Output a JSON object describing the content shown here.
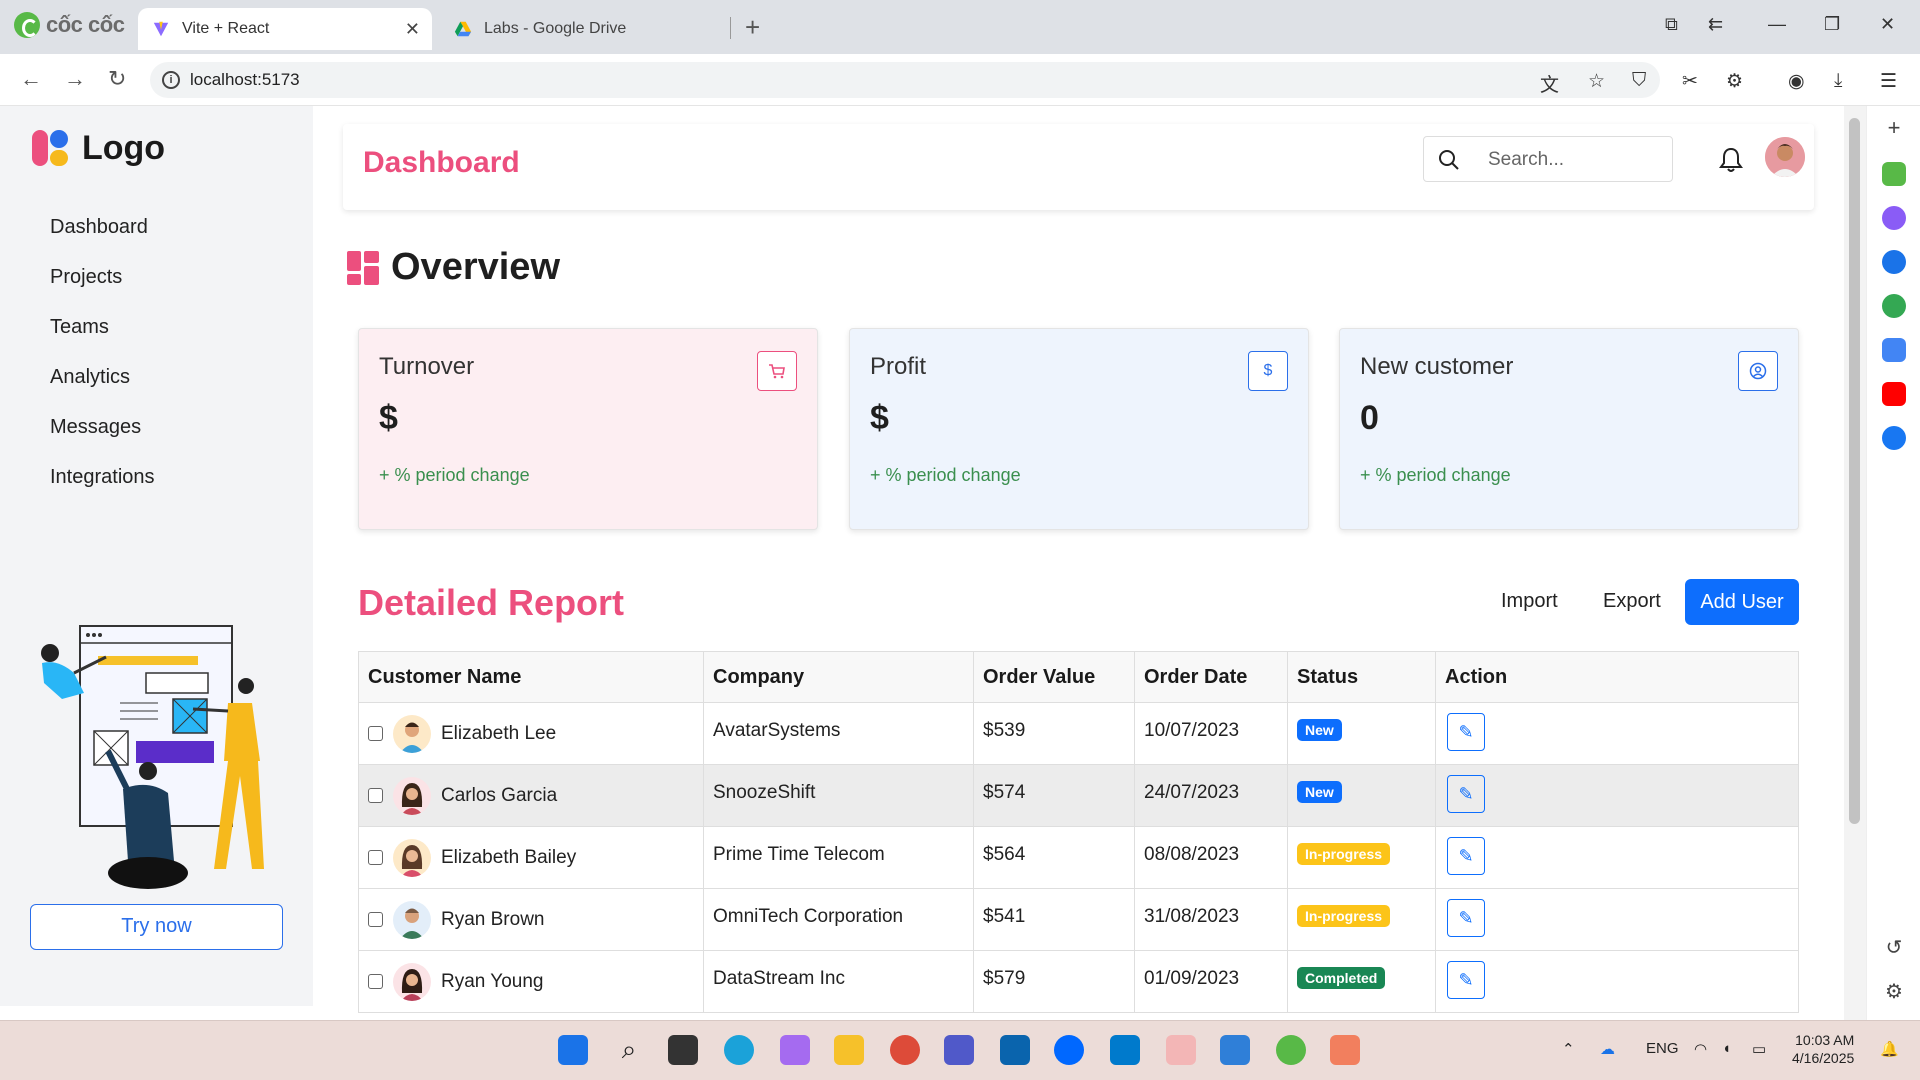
{
  "browser": {
    "brand": "cốc cốc",
    "tabs": [
      {
        "title": "Vite + React",
        "active": true
      },
      {
        "title": "Labs - Google Drive",
        "active": false
      }
    ],
    "url": "localhost:5173"
  },
  "sidebar": {
    "logo_text": "Logo",
    "items": [
      {
        "label": "Dashboard"
      },
      {
        "label": "Projects"
      },
      {
        "label": "Teams"
      },
      {
        "label": "Analytics"
      },
      {
        "label": "Messages"
      },
      {
        "label": "Integrations"
      }
    ],
    "cta_label": "Try now"
  },
  "header": {
    "title": "Dashboard",
    "search_placeholder": "Search..."
  },
  "overview": {
    "title": "Overview",
    "cards": [
      {
        "label": "Turnover",
        "value": "$",
        "change": "+ % period change",
        "icon": "cart-icon",
        "color": "#ec4f7e",
        "bg": "#fdeef2"
      },
      {
        "label": "Profit",
        "value": "$",
        "change": "+ % period change",
        "icon": "dollar-icon",
        "color": "#2b6fea",
        "bg": "#eef4fd"
      },
      {
        "label": "New customer",
        "value": "0",
        "change": "+ % period change",
        "icon": "user-circle-icon",
        "color": "#2b6fea",
        "bg": "#eef4fd"
      }
    ]
  },
  "report": {
    "title": "Detailed Report",
    "import_label": "Import",
    "export_label": "Export",
    "add_label": "Add User",
    "columns": [
      "Customer Name",
      "Company",
      "Order Value",
      "Order Date",
      "Status",
      "Action"
    ],
    "rows": [
      {
        "name": "Elizabeth Lee",
        "company": "AvatarSystems",
        "value": "$539",
        "date": "10/07/2023",
        "status": "New"
      },
      {
        "name": "Carlos Garcia",
        "company": "SnoozeShift",
        "value": "$574",
        "date": "24/07/2023",
        "status": "New"
      },
      {
        "name": "Elizabeth Bailey",
        "company": "Prime Time Telecom",
        "value": "$564",
        "date": "08/08/2023",
        "status": "In-progress"
      },
      {
        "name": "Ryan Brown",
        "company": "OmniTech Corporation",
        "value": "$541",
        "date": "31/08/2023",
        "status": "In-progress"
      },
      {
        "name": "Ryan Young",
        "company": "DataStream Inc",
        "value": "$579",
        "date": "01/09/2023",
        "status": "Completed"
      }
    ]
  },
  "taskbar": {
    "lang": "ENG",
    "time": "10:03 AM",
    "date": "4/16/2025"
  },
  "colors": {
    "accent_pink": "#ec4f7e",
    "primary_blue": "#0d6efd",
    "status_new": "#0d6efd",
    "status_progress": "#fcc419",
    "status_completed": "#198754"
  }
}
